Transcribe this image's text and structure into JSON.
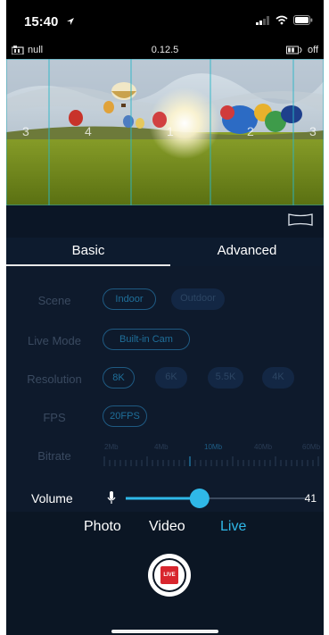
{
  "status_bar": {
    "time": "15:40"
  },
  "camera_bar": {
    "left_text": "null",
    "center_text": "0.12.5",
    "right_text": "off"
  },
  "preview": {
    "markers": [
      "3",
      "4",
      "1",
      "2",
      "3"
    ]
  },
  "tabs": [
    {
      "label": "Basic",
      "active": true
    },
    {
      "label": "Advanced",
      "active": false
    }
  ],
  "settings": {
    "scene": {
      "label": "Scene",
      "options": [
        "Indoor",
        "Outdoor"
      ],
      "selected": "Indoor"
    },
    "live_mode": {
      "label": "Live Mode",
      "options": [
        "Built-in Cam"
      ],
      "selected": "Built-in Cam"
    },
    "resolution": {
      "label": "Resolution",
      "options": [
        "8K",
        "6K",
        "5.5K",
        "4K"
      ],
      "selected": "8K"
    },
    "fps": {
      "label": "FPS",
      "options": [
        "20FPS"
      ],
      "selected": "20FPS"
    },
    "bitrate": {
      "label": "Bitrate",
      "ticks": [
        "2Mb",
        "4Mb",
        "10Mb",
        "40Mb",
        "60Mb"
      ],
      "selected": "10Mb"
    }
  },
  "volume": {
    "label": "Volume",
    "value": "41",
    "level": 0.41
  },
  "modes": [
    {
      "label": "Photo",
      "active": false
    },
    {
      "label": "Video",
      "active": false
    },
    {
      "label": "Live",
      "active": true
    }
  ],
  "shutter": {
    "badge": "LIVE"
  },
  "colors": {
    "accent": "#2fb8e8",
    "live_red": "#d8262e",
    "bg": "#0e1a2c"
  }
}
